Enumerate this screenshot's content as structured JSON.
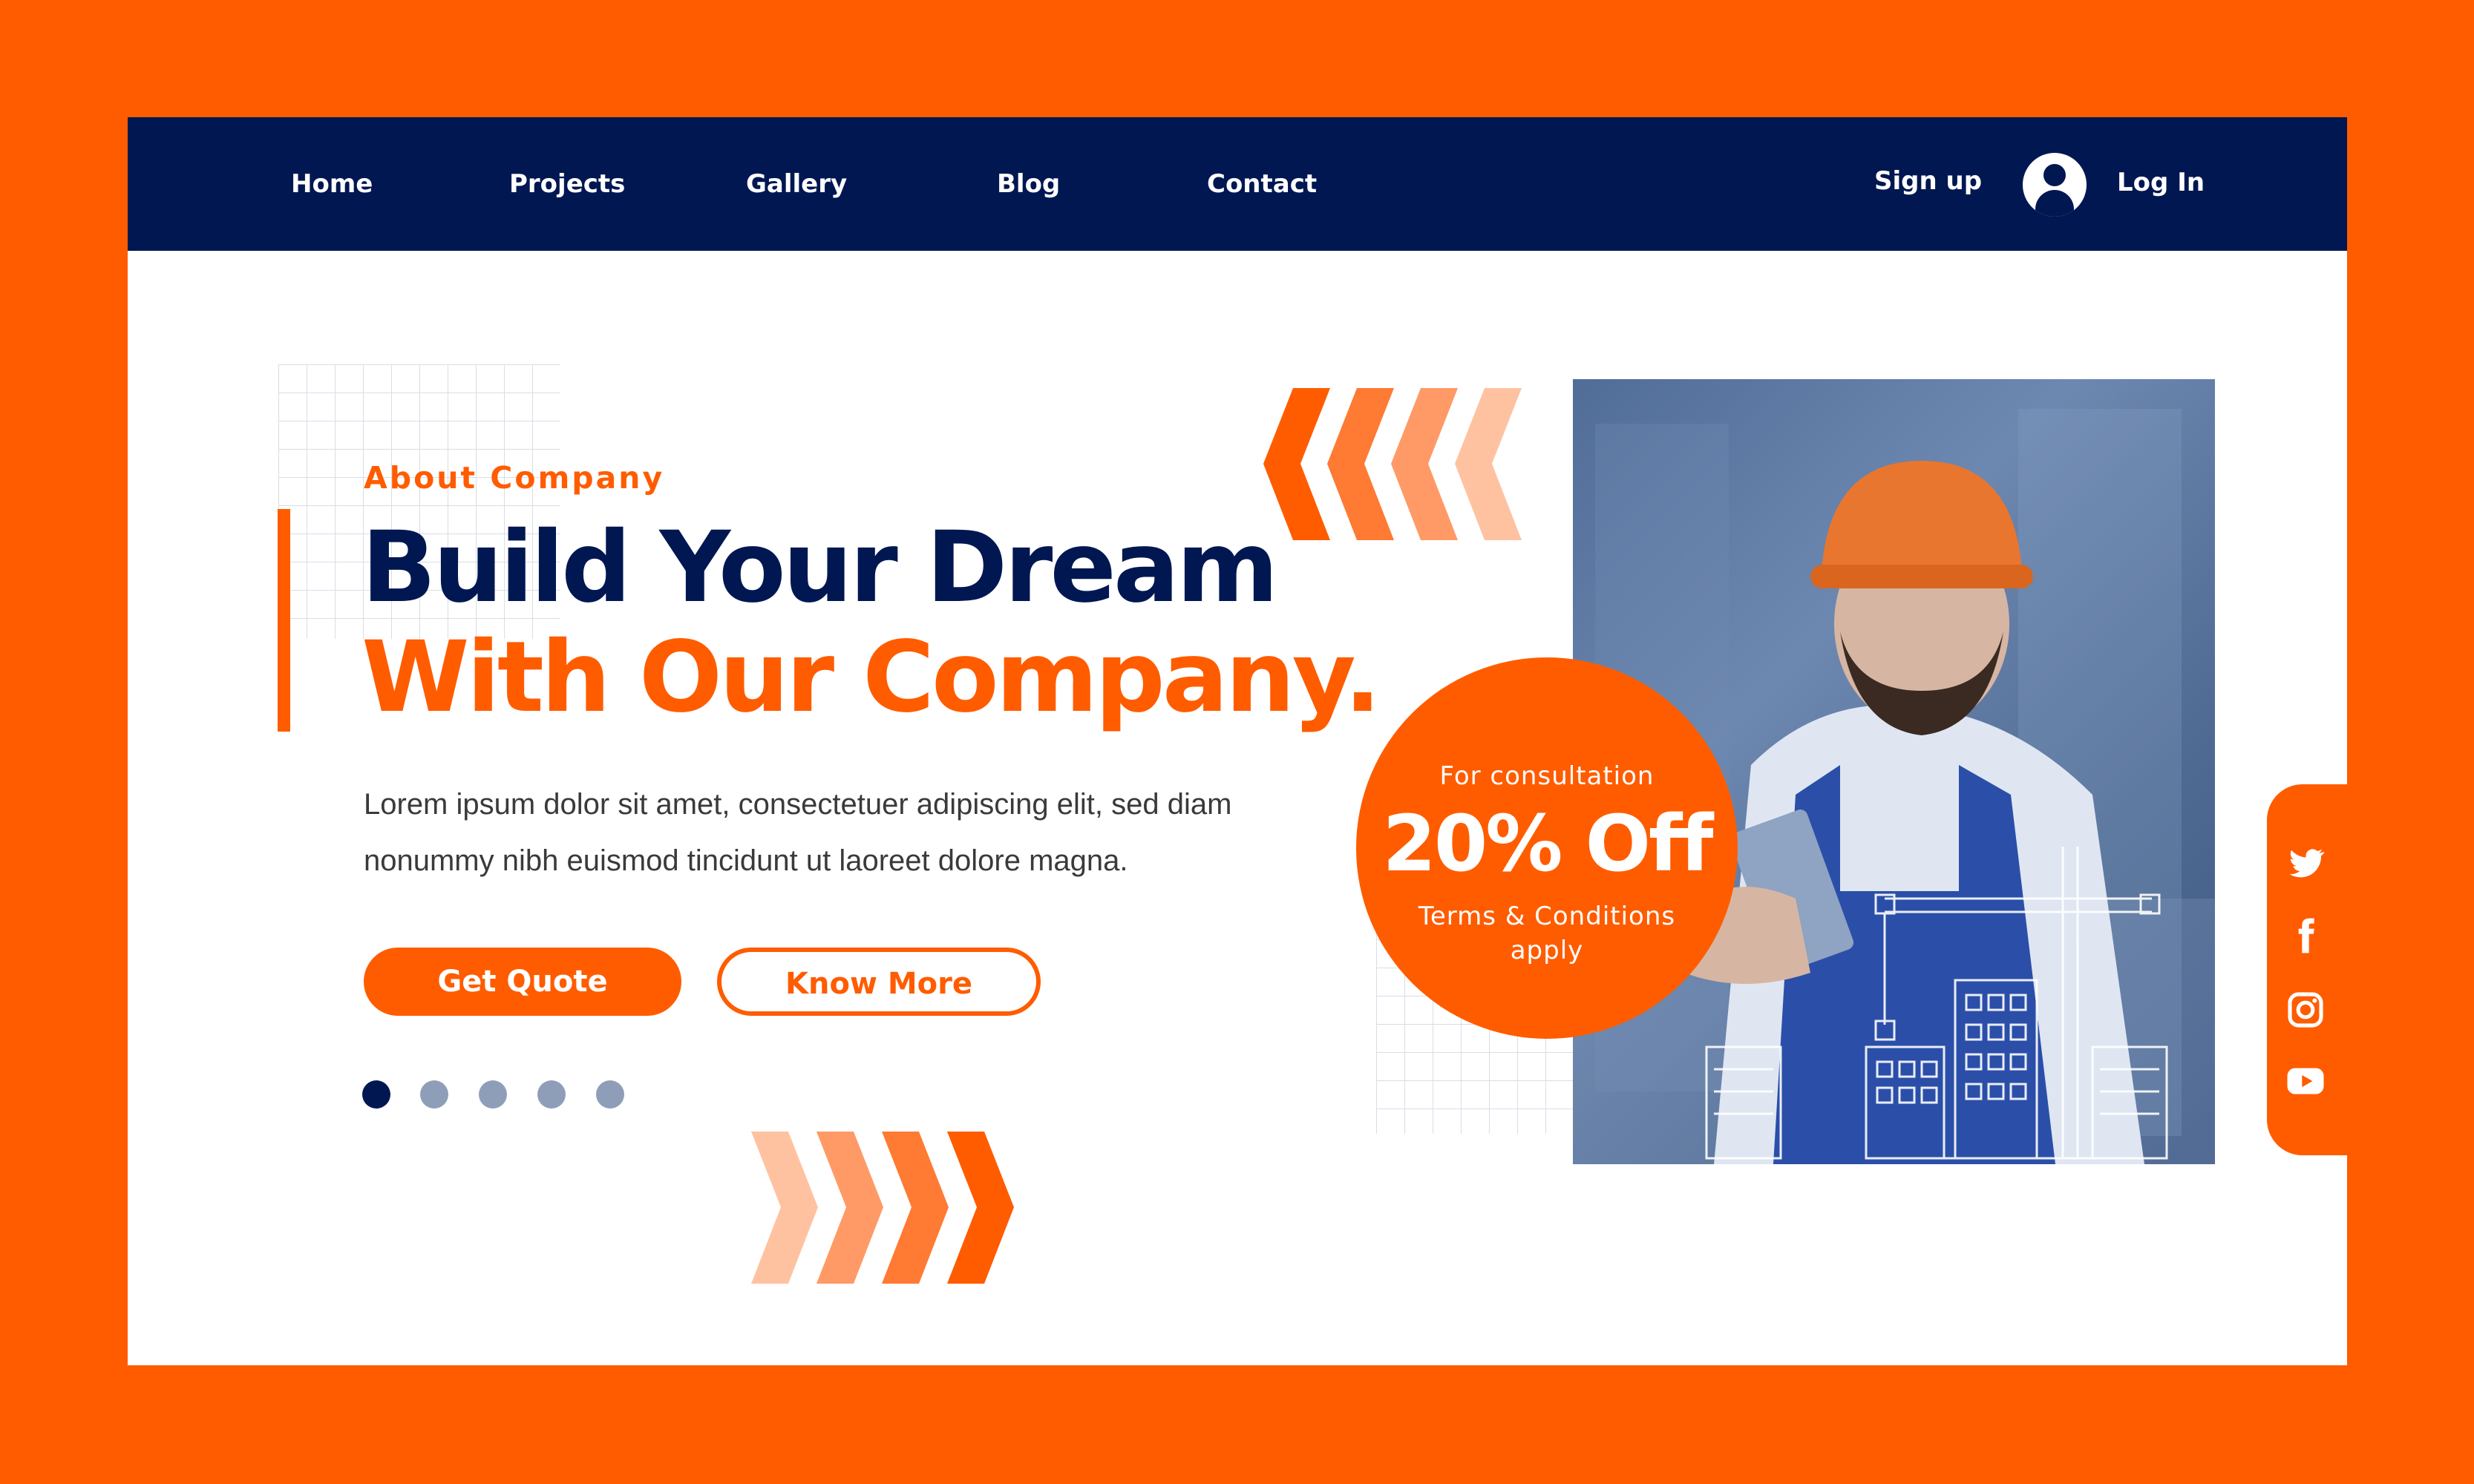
{
  "nav": {
    "items": [
      {
        "label": "Home"
      },
      {
        "label": "Projects"
      },
      {
        "label": "Gallery"
      },
      {
        "label": "Blog"
      },
      {
        "label": "Contact"
      }
    ],
    "signup": "Sign up",
    "login": "Log In"
  },
  "hero": {
    "eyebrow": "About Company",
    "title_line1": "Build Your Dream",
    "title_line2": "With Our Company.",
    "body_line1": "Lorem ipsum dolor sit amet, consectetuer adipiscing elit, sed diam",
    "body_line2": "nonummy nibh euismod tincidunt ut laoreet dolore magna.",
    "primary_button": "Get Quote",
    "secondary_button": "Know More"
  },
  "carousel": {
    "count": 5,
    "active_index": 0
  },
  "promo": {
    "top": "For consultation",
    "discount": "20% Off",
    "terms": "Terms & Conditions apply"
  },
  "social": [
    "twitter-icon",
    "facebook-icon",
    "instagram-icon",
    "youtube-icon"
  ],
  "colors": {
    "accent": "#ff5c00",
    "navy": "#001752",
    "dot_inactive": "#8f9eb8"
  }
}
